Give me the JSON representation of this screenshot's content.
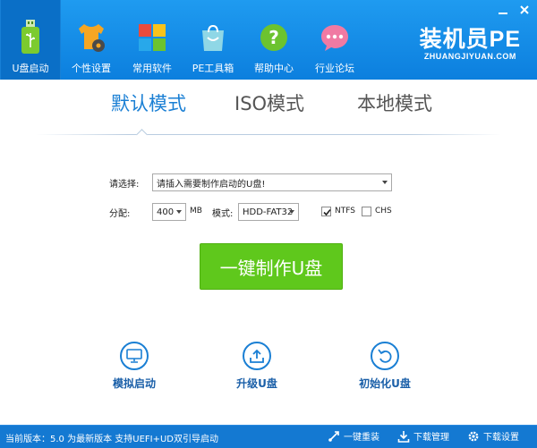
{
  "window": {
    "minimize_icon": "minimize-icon",
    "close_icon": "close-icon"
  },
  "nav": {
    "items": [
      {
        "label": "U盘启动",
        "icon": "usb-drive-icon"
      },
      {
        "label": "个性设置",
        "icon": "tshirt-gear-icon"
      },
      {
        "label": "常用软件",
        "icon": "tiles-icon"
      },
      {
        "label": "PE工具箱",
        "icon": "shopping-bag-icon"
      },
      {
        "label": "帮助中心",
        "icon": "question-icon"
      },
      {
        "label": "行业论坛",
        "icon": "chat-bubble-icon"
      }
    ],
    "active_index": 0
  },
  "brand": {
    "title": "装机员PE",
    "subtitle": "ZHUANGJIYUAN.COM"
  },
  "tabs": [
    "默认模式",
    "ISO模式",
    "本地模式"
  ],
  "form": {
    "select_label": "请选择:",
    "select_value": "请插入需要制作启动的U盘!",
    "partition_label": "分配:",
    "partition_value": "400",
    "partition_unit": "MB",
    "mode_label": "模式:",
    "mode_value": "HDD-FAT32",
    "ntfs_label": "NTFS",
    "ntfs_checked": true,
    "chs_label": "CHS",
    "chs_checked": false
  },
  "primary_button": "一键制作U盘",
  "tools": [
    {
      "label": "模拟启动",
      "icon": "monitor-icon"
    },
    {
      "label": "升级U盘",
      "icon": "upload-tray-icon"
    },
    {
      "label": "初始化U盘",
      "icon": "undo-icon"
    }
  ],
  "status": {
    "text": "当前版本：5.0 为最新版本 支持UEFI+UD双引导启动",
    "actions": [
      {
        "label": "一键重装",
        "icon": "reinstall-icon"
      },
      {
        "label": "下载管理",
        "icon": "download-icon"
      },
      {
        "label": "下载设置",
        "icon": "settings-gear-icon"
      }
    ]
  },
  "colors": {
    "header": "#1488e6",
    "accent": "#1a7fd4",
    "primary_button": "#5fc81c",
    "status_bar": "#1479d2"
  }
}
